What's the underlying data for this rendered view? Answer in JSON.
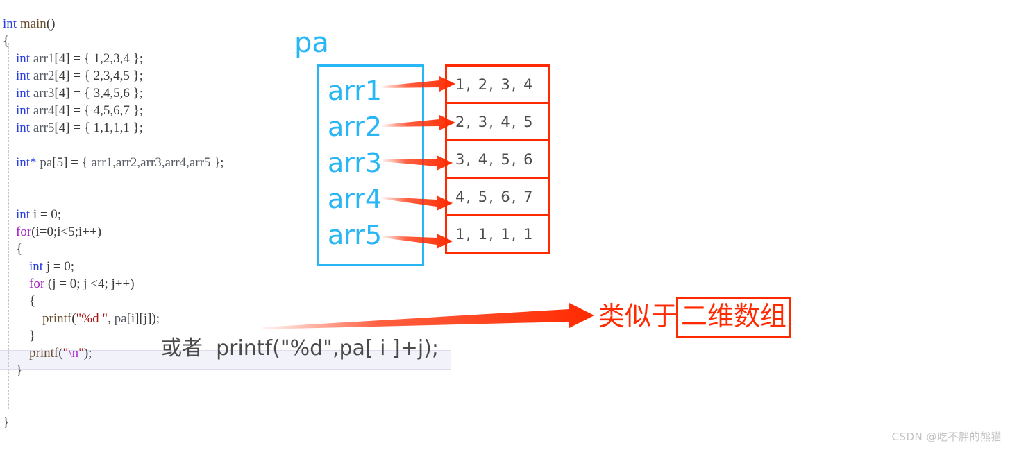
{
  "editor": {
    "language": "c",
    "lines": [
      {
        "indent": 0,
        "tokens": [
          {
            "t": "kw",
            "v": "int"
          },
          {
            "t": "pl",
            "v": " "
          },
          {
            "t": "fn",
            "v": "main"
          },
          {
            "t": "pl",
            "v": "()"
          }
        ]
      },
      {
        "indent": 0,
        "tokens": [
          {
            "t": "pl",
            "v": "{"
          }
        ]
      },
      {
        "indent": 1,
        "tokens": [
          {
            "t": "kw",
            "v": "int"
          },
          {
            "t": "pl",
            "v": " "
          },
          {
            "t": "id",
            "v": "arr1"
          },
          {
            "t": "pl",
            "v": "[4] = { 1,2,3,4 };"
          }
        ]
      },
      {
        "indent": 1,
        "tokens": [
          {
            "t": "kw",
            "v": "int"
          },
          {
            "t": "pl",
            "v": " "
          },
          {
            "t": "id",
            "v": "arr2"
          },
          {
            "t": "pl",
            "v": "[4] = { 2,3,4,5 };"
          }
        ]
      },
      {
        "indent": 1,
        "tokens": [
          {
            "t": "kw",
            "v": "int"
          },
          {
            "t": "pl",
            "v": " "
          },
          {
            "t": "id",
            "v": "arr3"
          },
          {
            "t": "pl",
            "v": "[4] = { 3,4,5,6 };"
          }
        ]
      },
      {
        "indent": 1,
        "tokens": [
          {
            "t": "kw",
            "v": "int"
          },
          {
            "t": "pl",
            "v": " "
          },
          {
            "t": "id",
            "v": "arr4"
          },
          {
            "t": "pl",
            "v": "[4] = { 4,5,6,7 };"
          }
        ]
      },
      {
        "indent": 1,
        "tokens": [
          {
            "t": "kw",
            "v": "int"
          },
          {
            "t": "pl",
            "v": " "
          },
          {
            "t": "id",
            "v": "arr5"
          },
          {
            "t": "pl",
            "v": "[4] = { 1,1,1,1 };"
          }
        ]
      },
      {
        "indent": 1,
        "tokens": []
      },
      {
        "indent": 1,
        "tokens": [
          {
            "t": "kw",
            "v": "int*"
          },
          {
            "t": "pl",
            "v": " "
          },
          {
            "t": "id",
            "v": "pa"
          },
          {
            "t": "pl",
            "v": "[5] = { "
          },
          {
            "t": "id",
            "v": "arr1,arr2,arr3,arr4,arr5"
          },
          {
            "t": "pl",
            "v": " };"
          }
        ]
      },
      {
        "indent": 1,
        "tokens": []
      },
      {
        "indent": 1,
        "tokens": []
      },
      {
        "indent": 1,
        "tokens": [
          {
            "t": "kw",
            "v": "int"
          },
          {
            "t": "pl",
            "v": " i = 0;"
          }
        ]
      },
      {
        "indent": 1,
        "tokens": [
          {
            "t": "kw2",
            "v": "for"
          },
          {
            "t": "pl",
            "v": "(i=0;i<5;i++)"
          }
        ]
      },
      {
        "indent": 1,
        "tokens": [
          {
            "t": "pl",
            "v": "{"
          }
        ]
      },
      {
        "indent": 2,
        "tokens": [
          {
            "t": "kw",
            "v": "int"
          },
          {
            "t": "pl",
            "v": " j = 0;"
          }
        ]
      },
      {
        "indent": 2,
        "tokens": [
          {
            "t": "kw2",
            "v": "for"
          },
          {
            "t": "pl",
            "v": " (j = 0; j <4; j++)"
          }
        ]
      },
      {
        "indent": 2,
        "tokens": [
          {
            "t": "pl",
            "v": "{"
          }
        ]
      },
      {
        "indent": 3,
        "tokens": [
          {
            "t": "fn",
            "v": "printf"
          },
          {
            "t": "pl",
            "v": "("
          },
          {
            "t": "str",
            "v": "\"%d \""
          },
          {
            "t": "pl",
            "v": ", "
          },
          {
            "t": "id",
            "v": "pa"
          },
          {
            "t": "pl",
            "v": "[i][j]);"
          }
        ]
      },
      {
        "indent": 2,
        "tokens": [
          {
            "t": "pl",
            "v": "}"
          }
        ]
      },
      {
        "indent": 2,
        "tokens": [
          {
            "t": "fn",
            "v": "printf"
          },
          {
            "t": "pl",
            "v": "("
          },
          {
            "t": "str",
            "v": "\""
          },
          {
            "t": "esc",
            "v": "\\n"
          },
          {
            "t": "str",
            "v": "\""
          },
          {
            "t": "pl",
            "v": ");"
          }
        ]
      },
      {
        "indent": 1,
        "tokens": [
          {
            "t": "pl",
            "v": "}"
          }
        ]
      },
      {
        "indent": 1,
        "tokens": []
      },
      {
        "indent": 0,
        "tokens": []
      },
      {
        "indent": 0,
        "tokens": [
          {
            "t": "pl",
            "v": "}"
          }
        ]
      }
    ],
    "highlighted_line_text": "printf(\"\\n\");"
  },
  "diagram": {
    "pa_label": "pa",
    "pointer_entries": [
      {
        "name": "arr1",
        "values": "1, 2, 3, 4"
      },
      {
        "name": "arr2",
        "values": "2, 3, 4, 5"
      },
      {
        "name": "arr3",
        "values": "3, 4, 5, 6"
      },
      {
        "name": "arr4",
        "values": "4, 5, 6, 7"
      },
      {
        "name": "arr5",
        "values": "1, 1, 1, 1"
      }
    ],
    "pointer_box_color": "#29b6f6",
    "value_box_color": "#ff2a00"
  },
  "annotations": {
    "red_note_prefix": "类似于",
    "red_note_boxed": "二维数组",
    "alt_note": "或者  printf(\"%d\",pa[ i ]+j);"
  },
  "watermark": {
    "text": "CSDN @吃不胖的熊猫"
  }
}
